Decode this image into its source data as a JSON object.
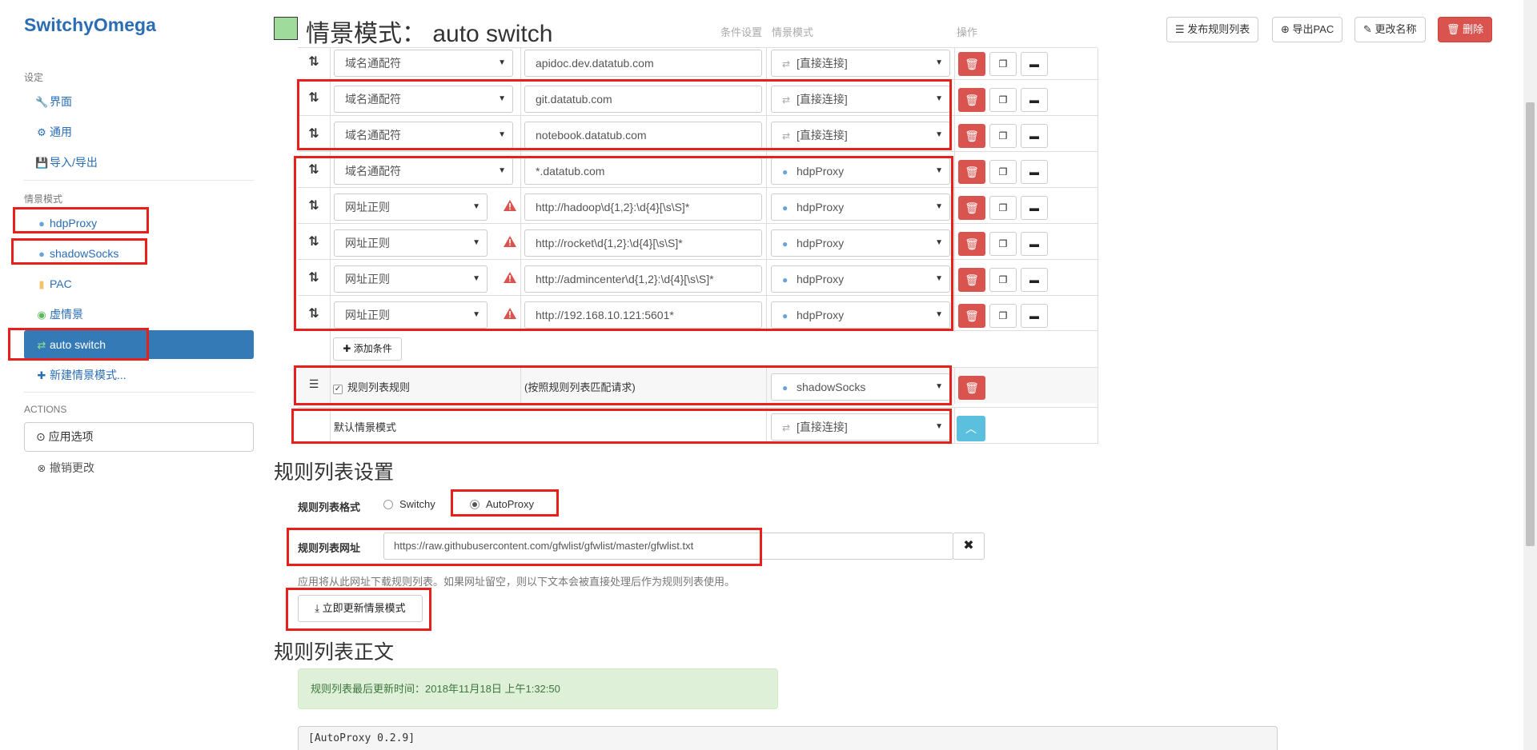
{
  "app": {
    "brand": "SwitchyOmega"
  },
  "sidebar": {
    "settings_header": "设定",
    "settings": [
      {
        "label": "界面",
        "icon": "wrench-icon"
      },
      {
        "label": "通用",
        "icon": "gear-icon"
      },
      {
        "label": "导入/导出",
        "icon": "floppy-icon"
      }
    ],
    "profiles_header": "情景模式",
    "profiles": [
      {
        "label": "hdpProxy",
        "icon": "globe-icon"
      },
      {
        "label": "shadowSocks",
        "icon": "globe-icon"
      },
      {
        "label": "PAC",
        "icon": "file-icon"
      },
      {
        "label": "虚情景",
        "icon": "virtual-icon"
      },
      {
        "label": "auto switch",
        "icon": "retweet-icon",
        "active": true
      },
      {
        "label": "新建情景模式...",
        "icon": "plus-icon"
      }
    ],
    "actions_header": "ACTIONS",
    "apply_label": "应用选项",
    "discard_label": "撤销更改"
  },
  "header": {
    "title": "情景模式： auto switch",
    "swatch_color": "#9fdc9b",
    "publish_label": "发布规则列表",
    "export_label": "导出PAC",
    "rename_label": "更改名称",
    "delete_label": "删除"
  },
  "table": {
    "headers": {
      "condition": "条件设置",
      "profile": "情景模式",
      "ops": "操作"
    },
    "rows": [
      {
        "type": "域名通配符",
        "value": "apidoc.dev.datatub.com",
        "profile": "[直接连接]",
        "direct": true,
        "warn": false
      },
      {
        "type": "域名通配符",
        "value": "git.datatub.com",
        "profile": "[直接连接]",
        "direct": true,
        "warn": false
      },
      {
        "type": "域名通配符",
        "value": "notebook.datatub.com",
        "profile": "[直接连接]",
        "direct": true,
        "warn": false
      },
      {
        "type": "域名通配符",
        "value": "*.datatub.com",
        "profile": "hdpProxy",
        "direct": false,
        "warn": false
      },
      {
        "type": "网址正则",
        "value": "http://hadoop\\d{1,2}:\\d{4}[\\s\\S]*",
        "profile": "hdpProxy",
        "direct": false,
        "warn": true
      },
      {
        "type": "网址正则",
        "value": "http://rocket\\d{1,2}:\\d{4}[\\s\\S]*",
        "profile": "hdpProxy",
        "direct": false,
        "warn": true
      },
      {
        "type": "网址正则",
        "value": "http://admincenter\\d{1,2}:\\d{4}[\\s\\S]*",
        "profile": "hdpProxy",
        "direct": false,
        "warn": true
      },
      {
        "type": "网址正则",
        "value": "http://192.168.10.121:5601*",
        "profile": "hdpProxy",
        "direct": false,
        "warn": true
      }
    ],
    "add_condition_label": "添加条件",
    "rule_list_row": {
      "label": "规则列表规则",
      "checked": true,
      "desc": "(按照规则列表匹配请求)",
      "profile": "shadowSocks"
    },
    "default_row": {
      "label": "默认情景模式",
      "profile": "[直接连接]"
    }
  },
  "rule_list_settings": {
    "heading": "规则列表设置",
    "format_label": "规则列表格式",
    "format_options": [
      "Switchy",
      "AutoProxy"
    ],
    "format_selected": "AutoProxy",
    "url_label": "规则列表网址",
    "url_value": "https://raw.githubusercontent.com/gfwlist/gfwlist/master/gfwlist.txt",
    "help_text": "应用将从此网址下载规则列表。如果网址留空，则以下文本会被直接处理后作为规则列表使用。",
    "update_button": "立即更新情景模式"
  },
  "rule_list_body": {
    "heading": "规则列表正文",
    "last_update": "规则列表最后更新时间：2018年11月18日 上午1:32:50",
    "content_first_line": "[AutoProxy 0.2.9]"
  }
}
